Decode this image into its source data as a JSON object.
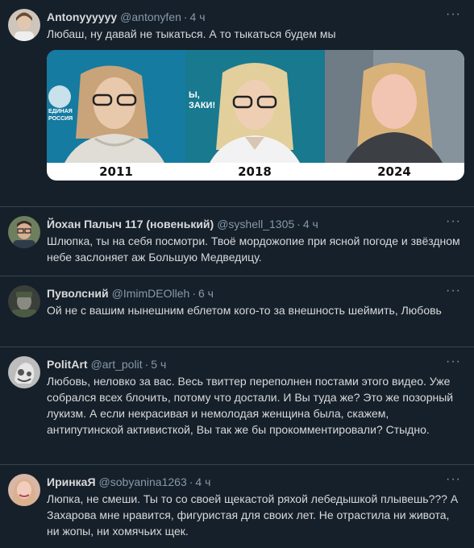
{
  "tweets": [
    {
      "name": "Antonyyyyyy",
      "handle": "@antonyfen",
      "time": "4 ч",
      "text": "Любаш, ну давай не тыкаться. А то тыкаться будем мы",
      "media": {
        "labels": [
          "2011",
          "2018",
          "2024"
        ],
        "banner_left": "ЕДИНАЯ РОССИЯ",
        "banner_mid": "Ы, ЗАКИ!"
      }
    },
    {
      "name": "Йохан Палыч 117 (новенький)",
      "handle": "@syshell_1305",
      "time": "4 ч",
      "text": "Шлюпка, ты на себя посмотри. Твоё мордожопие при ясной погоде и звёздном небе заслоняет аж Большую Медведицу."
    },
    {
      "name": "Пуволсний",
      "handle": "@ImimDEOlleh",
      "time": "6 ч",
      "text": "Ой не с вашим нынешним еблетом кого-то за внешность шеймить, Любовь"
    },
    {
      "name": "PolitArt",
      "handle": "@art_polit",
      "time": "5 ч",
      "text": "Любовь, неловко за вас. Весь твиттер переполнен постами этого видео. Уже собрался всех блочить, потому что достали. И Вы туда же? Это же позорный лукизм. А если некрасивая и немолодая женщина была, скажем, антипутинской активисткой, Вы так же бы прокомментировали? Стыдно."
    },
    {
      "name": "ИринкаЯ",
      "handle": "@sobyanina1263",
      "time": "4 ч",
      "text": "Люпка, не смеши. Ты то со своей щекастой ряхой лебедышкой плывешь??? А Захарова мне нравится, фигуристая для своих лет. Не отрастила ни живота, ни жопы, ни хомячьих щек."
    }
  ],
  "dot_separator": "·",
  "more_glyph": "···"
}
